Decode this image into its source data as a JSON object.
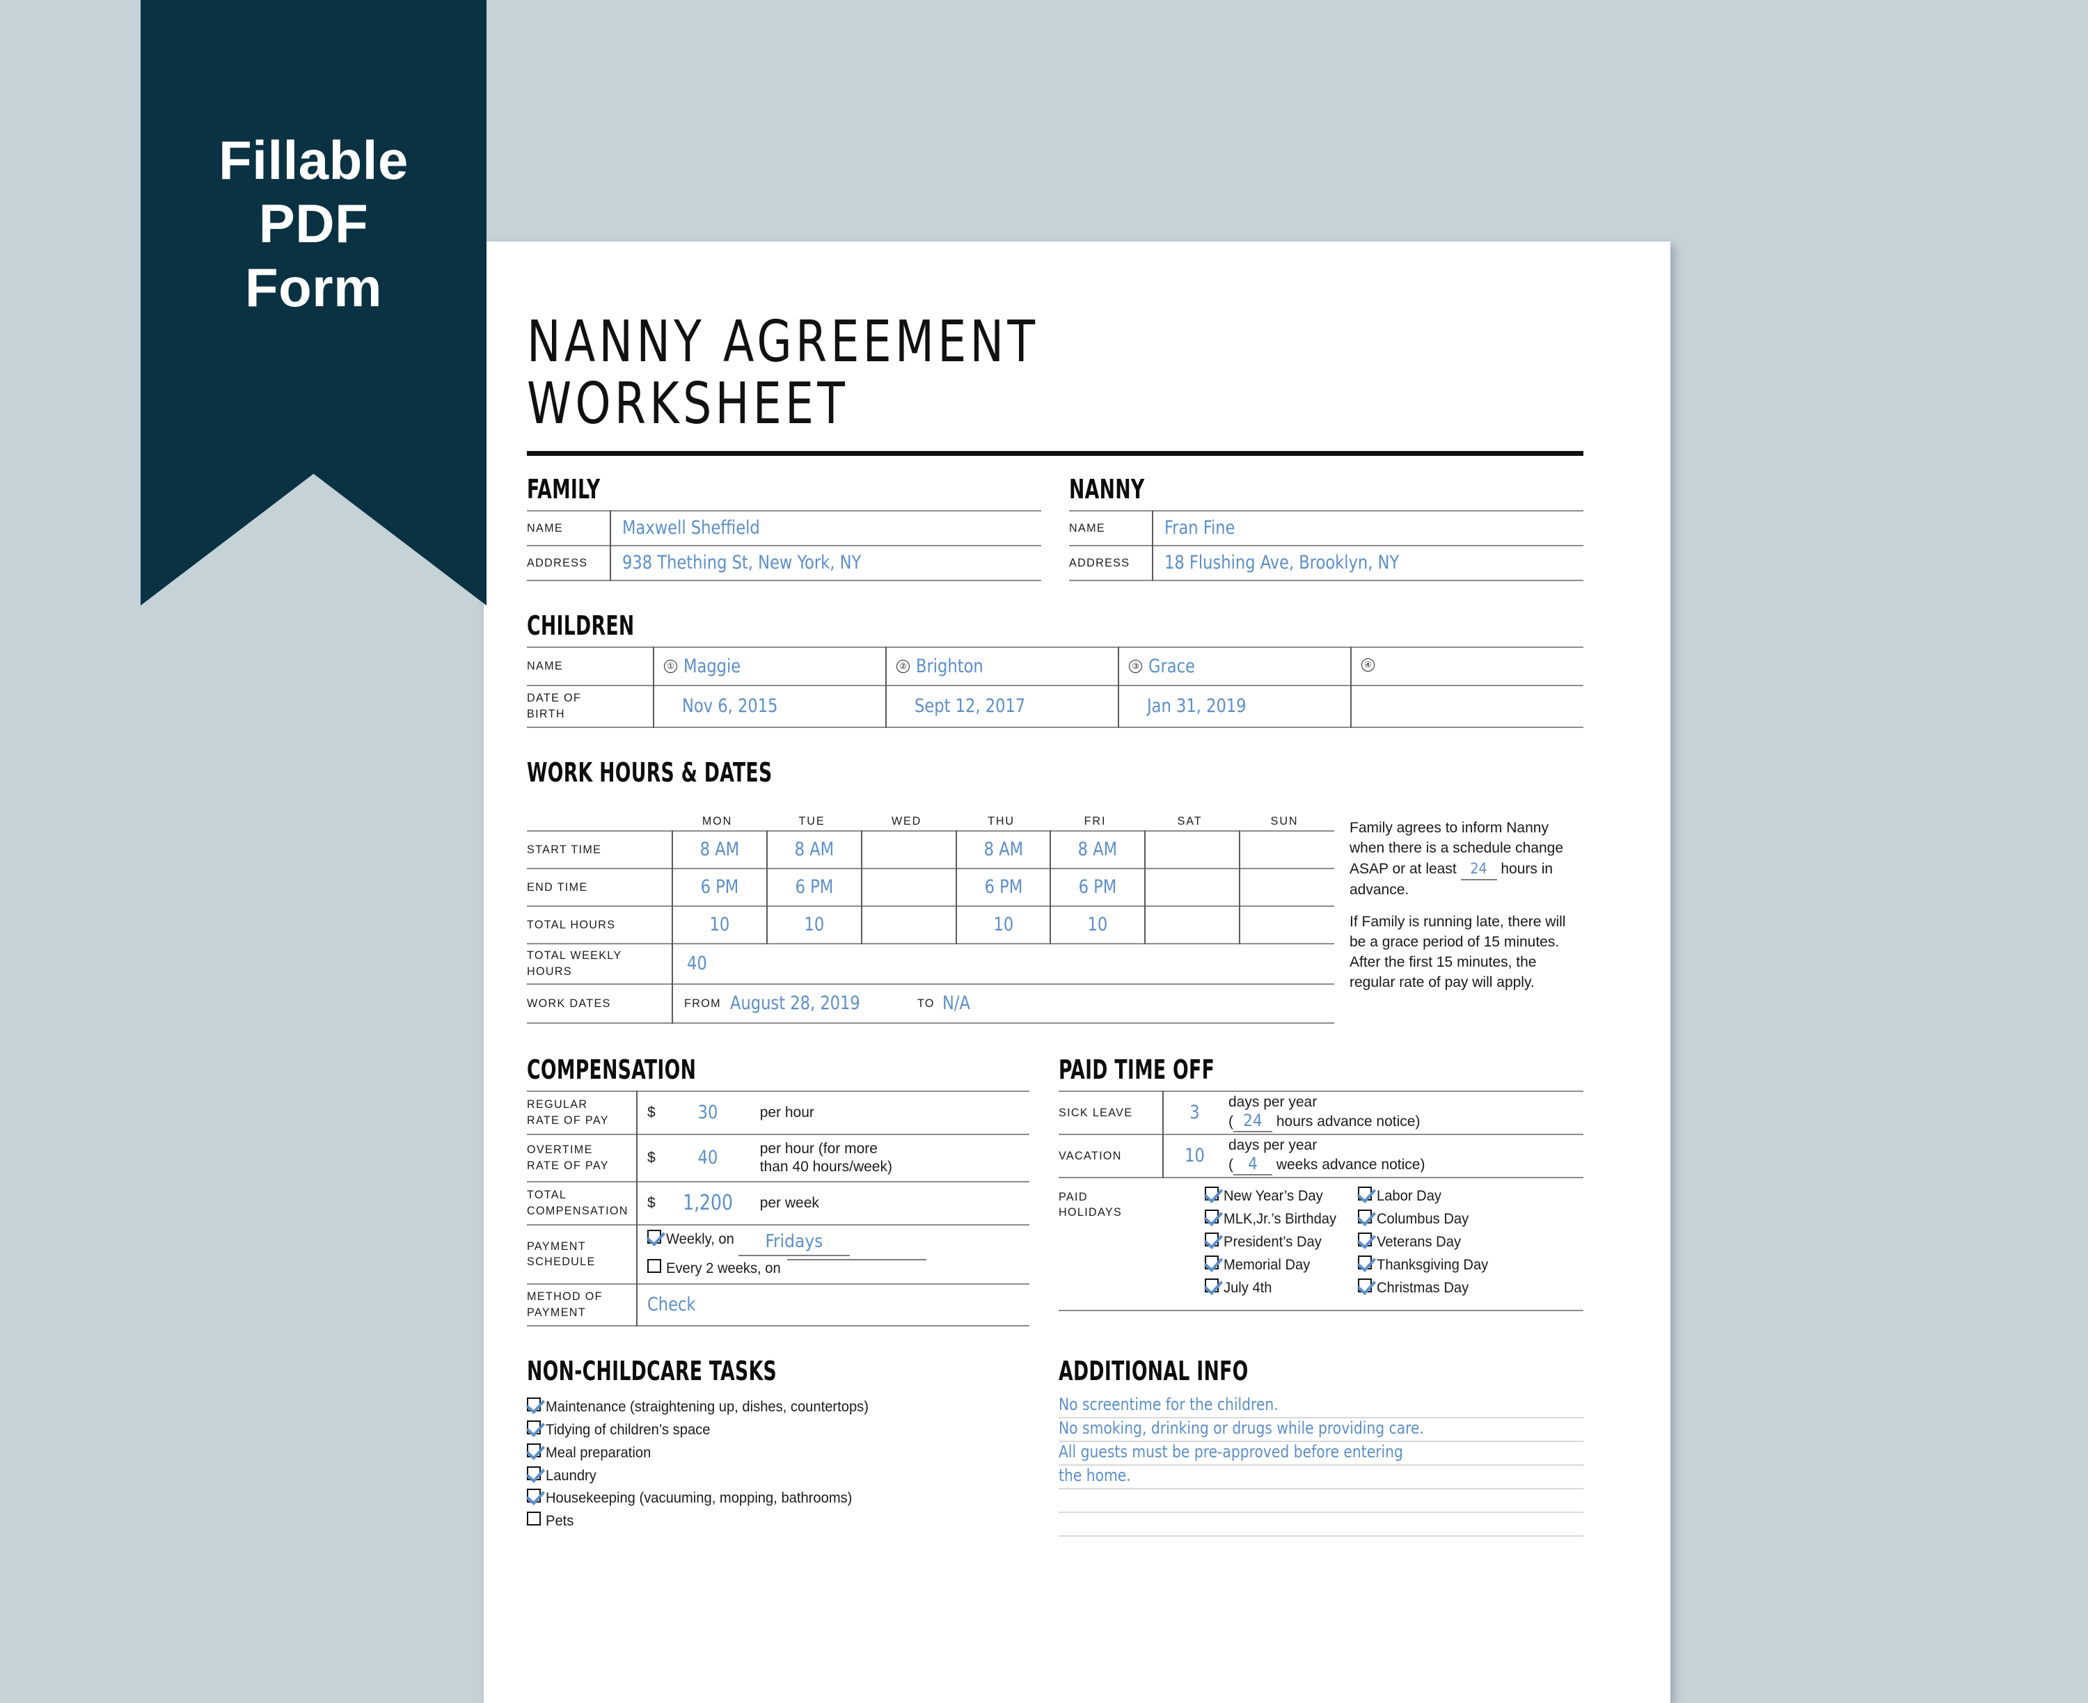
{
  "badge": {
    "line1": "Fillable",
    "line2": "PDF",
    "line3": "Form",
    "color": "#0a3242"
  },
  "document": {
    "title": "NANNY AGREEMENT\nWORKSHEET",
    "accent_blue": "#5b8fc9"
  },
  "family": {
    "heading": "FAMILY",
    "name_label": "NAME",
    "name_value": "Maxwell Sheffield",
    "address_label": "ADDRESS",
    "address_value": "938 Thething St, New York, NY"
  },
  "nanny": {
    "heading": "NANNY",
    "name_label": "NAME",
    "name_value": "Fran Fine",
    "address_label": "ADDRESS",
    "address_value": "18 Flushing Ave, Brooklyn, NY"
  },
  "children": {
    "heading": "CHILDREN",
    "name_label": "NAME",
    "dob_label": "DATE OF\nBIRTH",
    "entries": [
      {
        "num": "①",
        "name": "Maggie",
        "dob": "Nov 6, 2015"
      },
      {
        "num": "②",
        "name": "Brighton",
        "dob": "Sept 12, 2017"
      },
      {
        "num": "③",
        "name": "Grace",
        "dob": "Jan 31, 2019"
      },
      {
        "num": "④",
        "name": "",
        "dob": ""
      }
    ]
  },
  "work_hours": {
    "heading": "WORK HOURS & DATES",
    "days": [
      "MON",
      "TUE",
      "WED",
      "THU",
      "FRI",
      "SAT",
      "SUN"
    ],
    "rows": [
      {
        "label": "START TIME",
        "values": [
          "8 AM",
          "8 AM",
          "",
          "8 AM",
          "8 AM",
          "",
          ""
        ]
      },
      {
        "label": "END TIME",
        "values": [
          "6 PM",
          "6 PM",
          "",
          "6 PM",
          "6 PM",
          "",
          ""
        ]
      },
      {
        "label": "TOTAL HOURS",
        "values": [
          "10",
          "10",
          "",
          "10",
          "10",
          "",
          ""
        ]
      }
    ],
    "total_weekly_label": "TOTAL WEEKLY\nHOURS",
    "total_weekly_value": "40",
    "work_dates_label": "WORK DATES",
    "from_label": "FROM",
    "from_value": "August 28, 2019",
    "to_label": "TO",
    "to_value": "N/A",
    "notes": [
      {
        "before": "Family agrees to inform Nanny when there is a schedule change ASAP or at least ",
        "fill": "24",
        "after": " hours in advance."
      },
      {
        "before": "If Family is running late, there will be a grace period of 15 minutes. After the first 15 minutes, the regular rate of pay will apply.",
        "fill": "",
        "after": ""
      }
    ]
  },
  "compensation": {
    "heading": "COMPENSATION",
    "regular_label": "REGULAR\nRATE OF PAY",
    "regular_currency": "$",
    "regular_value": "30",
    "regular_unit": "per hour",
    "overtime_label": "OVERTIME\nRATE OF PAY",
    "overtime_currency": "$",
    "overtime_value": "40",
    "overtime_unit": "per hour (for more\nthan 40 hours/week)",
    "total_label": "TOTAL\nCOMPENSATION",
    "total_currency": "$",
    "total_value": "1,200",
    "total_unit": "per week",
    "schedule_label": "PAYMENT\nSCHEDULE",
    "schedule_options": [
      {
        "checked": true,
        "text": "Weekly, on ",
        "fill": "Fridays"
      },
      {
        "checked": false,
        "text": "Every 2 weeks, on ",
        "fill": ""
      }
    ],
    "method_label": "METHOD OF\nPAYMENT",
    "method_value": "Check"
  },
  "paid_time_off": {
    "heading": "PAID TIME OFF",
    "sick_label": "SICK LEAVE",
    "sick_value": "3",
    "sick_unit_1": "days per year",
    "sick_notice_open": "(",
    "sick_notice_value": "24",
    "sick_notice_text": " hours advance notice)",
    "vacation_label": "VACATION",
    "vacation_value": "10",
    "vacation_unit_1": "days per year",
    "vacation_notice_open": "(",
    "vacation_notice_value": "4",
    "vacation_notice_text": " weeks advance notice)",
    "holidays_label": "PAID\nHOLIDAYS",
    "holidays_col1": [
      {
        "checked": true,
        "label": "New Year’s Day"
      },
      {
        "checked": true,
        "label": "MLK,Jr.’s Birthday"
      },
      {
        "checked": true,
        "label": "President’s Day"
      },
      {
        "checked": true,
        "label": "Memorial Day"
      },
      {
        "checked": true,
        "label": "July 4th"
      }
    ],
    "holidays_col2": [
      {
        "checked": true,
        "label": "Labor Day"
      },
      {
        "checked": true,
        "label": "Columbus Day"
      },
      {
        "checked": true,
        "label": "Veterans Day"
      },
      {
        "checked": true,
        "label": "Thanksgiving Day"
      },
      {
        "checked": true,
        "label": "Christmas Day"
      }
    ]
  },
  "non_childcare": {
    "heading": "NON-CHILDCARE TASKS",
    "tasks": [
      {
        "checked": true,
        "label": "Maintenance (straightening up, dishes, countertops)"
      },
      {
        "checked": true,
        "label": "Tidying of children’s space"
      },
      {
        "checked": true,
        "label": "Meal preparation"
      },
      {
        "checked": true,
        "label": "Laundry"
      },
      {
        "checked": true,
        "label": "Housekeeping (vacuuming, mopping, bathrooms)"
      },
      {
        "checked": false,
        "label": "Pets"
      }
    ]
  },
  "additional_info": {
    "heading": "ADDITIONAL INFO",
    "lines": [
      "No screentime for the children.",
      "No smoking, drinking or drugs while providing care.",
      "All guests must be pre-approved before entering",
      "the home.",
      "",
      ""
    ]
  }
}
